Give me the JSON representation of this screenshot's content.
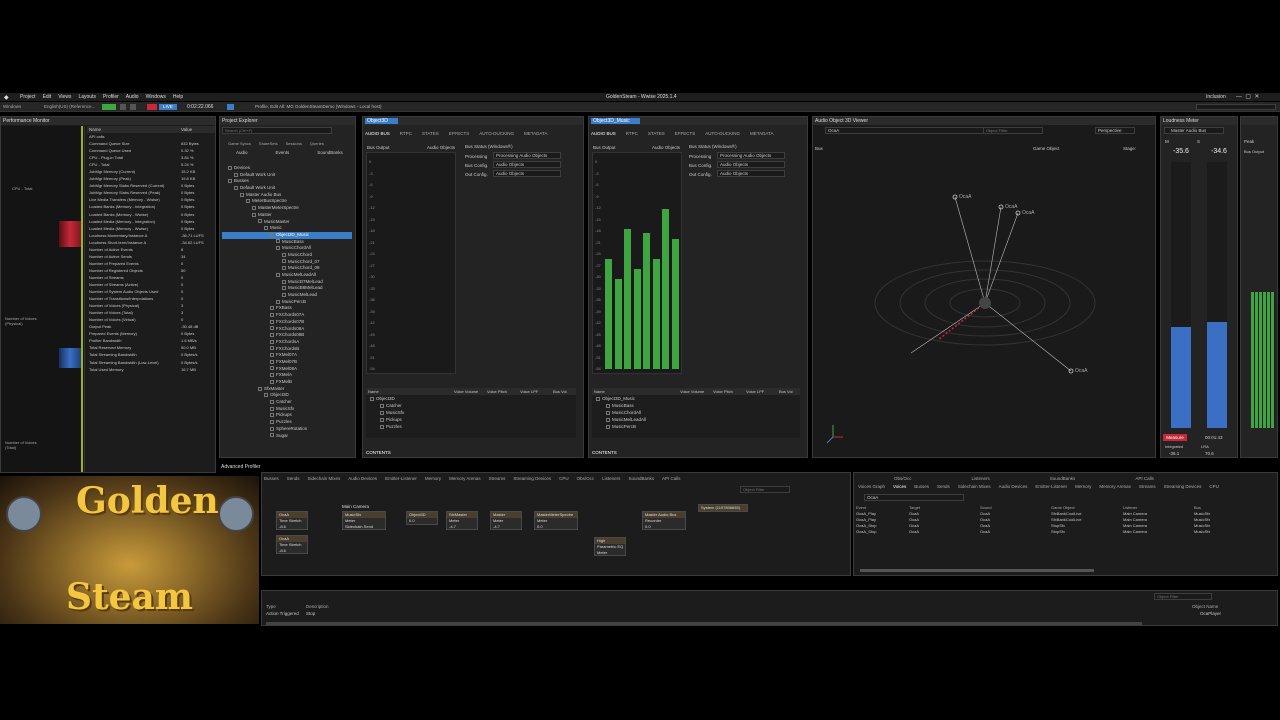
{
  "app": {
    "title": "GoldenSteam - Wwise 2025.1.4",
    "menu": [
      "Project",
      "Edit",
      "Views",
      "Layouts",
      "Profiler",
      "Audio",
      "Windows",
      "Help"
    ],
    "platform": "Windows",
    "language": "English(US) (Reference...",
    "live": "LIVE",
    "time": "0:02:22.066",
    "status": "Profile, Edit All: MG GoldenSteamDemo (Windows - Local host)",
    "user": "Inclusion"
  },
  "perf": {
    "title": "Performance Monitor",
    "col_name": "Name",
    "col_value": "Value",
    "label_cpu": "CPU - Total",
    "label_voices_phys": "Number of Voices (Physical)",
    "label_voices_total": "Number of Voices (Total)",
    "rows": [
      [
        "API calls",
        ""
      ],
      [
        "Command Queue Size",
        "832 Bytes"
      ],
      [
        "Command Queue Used",
        "0.32 %"
      ],
      [
        "CPU - Plug-in Total",
        "3.84 %"
      ],
      [
        "CPU - Total",
        "5.24 %"
      ],
      [
        "JobMgr Memory (Current)",
        "15.2 KB"
      ],
      [
        "JobMgr Memory (Peak)",
        "19.8 KB"
      ],
      [
        "JobMgr Memory Slabs Reserved (Current)",
        "0 Bytes"
      ],
      [
        "JobMgr Memory Slabs Reserved (Peak)",
        "0 Bytes"
      ],
      [
        "Live Media Transfers (Memory - Wwise)",
        "0 Bytes"
      ],
      [
        "Loaded Banks (Memory - Integration)",
        "0 Bytes"
      ],
      [
        "Loaded Banks (Memory - Wwise)",
        "0 Bytes"
      ],
      [
        "Loaded Media (Memory - Integration)",
        "0 Bytes"
      ],
      [
        "Loaded Media (Memory - Wwise)",
        "0 Bytes"
      ],
      [
        "Loudness Momentary/Instance A",
        "-36.71 LUFS"
      ],
      [
        "Loudness Short-term/Instance A",
        "-34.62 LUFS"
      ],
      [
        "Number of Active Events",
        "8"
      ],
      [
        "Number of Active Sends",
        "34"
      ],
      [
        "Number of Prepared Events",
        "0"
      ],
      [
        "Number of Registered Objects",
        "50"
      ],
      [
        "Number of Streams",
        "0"
      ],
      [
        "Number of Streams (Active)",
        "0"
      ],
      [
        "Number of System Audio Objects Used",
        "0"
      ],
      [
        "Number of Transitions/Interpolations",
        "0"
      ],
      [
        "Number of Voices (Physical)",
        "3"
      ],
      [
        "Number of Voices (Total)",
        "3"
      ],
      [
        "Number of Voices (Virtual)",
        "0"
      ],
      [
        "Output Peak",
        "-30.48 dB"
      ],
      [
        "Prepared Events (Memory)",
        "0 Bytes"
      ],
      [
        "Profiler Bandwidth",
        "1.6 MB/s"
      ],
      [
        "Total Reserved Memory",
        "50.0 MB"
      ],
      [
        "Total Streaming Bandwidth",
        "0 Bytes/s"
      ],
      [
        "Total Streaming Bandwidth (Low-Level)",
        "0 Bytes/s"
      ],
      [
        "Total Used Memory",
        "16.7 MB"
      ]
    ]
  },
  "explorer": {
    "title": "Project Explorer",
    "search": "Search (Ctrl+F)",
    "tabs_top": [
      "Game Syncs",
      "ShareSets",
      "Sessions",
      "Queries"
    ],
    "tabs": [
      "Audio",
      "Events",
      "SoundBanks"
    ],
    "items": [
      [
        "Devices",
        1
      ],
      [
        "Default Work Unit",
        2
      ],
      [
        "Busses",
        1
      ],
      [
        "Default Work Unit",
        2
      ],
      [
        "Master Audio Bus",
        3
      ],
      [
        "MeterBusSpectre",
        4
      ],
      [
        "MasterMeterSpectre",
        5
      ],
      [
        "Master",
        5
      ],
      [
        "MusicMaster",
        6
      ],
      [
        "Music",
        7
      ],
      [
        "Object3D_Music",
        8
      ],
      [
        "MusicBass",
        9
      ],
      [
        "MusicChordAll",
        9
      ],
      [
        "MusicChord",
        10
      ],
      [
        "MusicChord_07",
        10
      ],
      [
        "MusicChord_08",
        10
      ],
      [
        "MusicMelLeadAll",
        9
      ],
      [
        "MusicD7MelLead",
        10
      ],
      [
        "MusicB8MelLead",
        10
      ],
      [
        "MusicMelLead",
        10
      ],
      [
        "MusicPercB",
        9
      ],
      [
        "FXBass",
        8
      ],
      [
        "FXChords07A",
        8
      ],
      [
        "FXChords07B",
        8
      ],
      [
        "FXChords08A",
        8
      ],
      [
        "FXChords08B",
        8
      ],
      [
        "FXChordsA",
        8
      ],
      [
        "FXChordsB",
        8
      ],
      [
        "FXMel07A",
        8
      ],
      [
        "FXMel07B",
        8
      ],
      [
        "FXMel08A",
        8
      ],
      [
        "FXMelA",
        8
      ],
      [
        "FXMelB",
        8
      ],
      [
        "SfxMaster",
        6
      ],
      [
        "Object3D",
        7
      ],
      [
        "Catcher",
        8
      ],
      [
        "MusicSfx",
        8
      ],
      [
        "Pickups",
        8
      ],
      [
        "Puzzles",
        8
      ],
      [
        "SphereRotation",
        8
      ],
      [
        "Sugar",
        8
      ]
    ]
  },
  "bus1": {
    "title": "Object3D",
    "tabs": [
      "AUDIO BUS",
      "RTPC",
      "STATES",
      "EFFECTS",
      "AUTO-DUCKING",
      "METADATA"
    ],
    "label_output": "Bus Output",
    "label_objects": "Audio Objects",
    "label_status": "Bus Status (Windows®)",
    "processing_label": "Processing",
    "processing_value": "Processing Audio Objects",
    "busconfig_label": "Bus Config.",
    "busconfig_value": "Audio Objects",
    "outconfig_label": "Out Config.",
    "outconfig_value": "Audio Objects",
    "scale": [
      "0",
      "-3",
      "-6",
      "-9",
      "-12",
      "-15",
      "-18",
      "-21",
      "-24",
      "-27",
      "-30",
      "-33",
      "-36",
      "-39",
      "-42",
      "-45",
      "-48",
      "-51",
      "-54"
    ],
    "cols": [
      "Name",
      "Voice Volume",
      "Voice Pitch",
      "Voice LPF",
      "Bus Vol"
    ],
    "rows": [
      "Object3D",
      "Catcher",
      "MusicSfx",
      "Pickups",
      "Puzzles"
    ],
    "levels": [],
    "contents": "CONTENTS"
  },
  "bus2": {
    "title": "Object3D_Music",
    "tabs": [
      "AUDIO BUS",
      "RTPC",
      "STATES",
      "EFFECTS",
      "AUTO-DUCKING",
      "METADATA"
    ],
    "label_output": "Bus Output",
    "label_objects": "Audio Objects",
    "label_status": "Bus Status (Windows®)",
    "processing_label": "Processing",
    "processing_value": "Processing Audio Objects",
    "busconfig_label": "Bus Config.",
    "busconfig_value": "Audio Objects",
    "outconfig_label": "Out Config.",
    "outconfig_value": "Audio Objects",
    "scale": [
      "0",
      "-3",
      "-6",
      "-9",
      "-12",
      "-15",
      "-18",
      "-21",
      "-24",
      "-27",
      "-30",
      "-33",
      "-36",
      "-39",
      "-42",
      "-45",
      "-48",
      "-51",
      "-54"
    ],
    "cols": [
      "Name",
      "Voice Volume",
      "Voice Pitch",
      "Voice LPF",
      "Bus Vol"
    ],
    "rows": [
      "Object3D_Music",
      "MusicBass",
      "MusicChordAll",
      "MusicMelLeadAll",
      "MusicPercB"
    ],
    "levels": [
      0.55,
      0.45,
      0.7,
      0.5,
      0.68,
      0.55,
      0.8,
      0.65
    ],
    "contents": "CONTENTS"
  },
  "viewer": {
    "title": "Audio Object 3D Viewer",
    "bus_field": "OcaA",
    "search": "Object Filter",
    "mode": "Perspective",
    "bus_label": "Bus",
    "game_object_label": "Game Object",
    "stage_label": "Stage:",
    "labels": [
      "OcaA",
      "OcaA",
      "OcaA",
      "OcaA"
    ]
  },
  "loudness": {
    "title": "Loudness Meter",
    "bus": "Master Audio Bus",
    "bus_output": "Bus Output",
    "m_label": "M",
    "s_label": "S",
    "m_value": "-35.6",
    "s_value": "-34.6",
    "measure": "Measure",
    "time": "00:01:43",
    "integrated_label": "Integrated",
    "integrated_value": "-36.1",
    "lra_label": "LRA",
    "lra_value": "70.6",
    "peak": "Peak",
    "m_level": 0.38,
    "s_level": 0.4
  },
  "advanced": {
    "title": "Advanced Profiler",
    "tabs": [
      "Busses",
      "Sends",
      "Sidechain Mixes",
      "Audio Devices",
      "Emitter-Listener",
      "Memory",
      "Memory Arenas",
      "Streams",
      "Streaming Devices",
      "CPU",
      "Obs/Occ",
      "Listeners",
      "SoundBanks",
      "API Calls"
    ],
    "filter": "Object Filter"
  },
  "graph": {
    "nodes": [
      [
        "OcaA",
        "Time Stretch",
        "-8.6"
      ],
      [
        "OcaA",
        "Time Stretch",
        "-8.6"
      ],
      [
        "MusicSfx",
        "Meter",
        "Sidechain Send"
      ],
      [
        "Object3D",
        "0.0",
        ""
      ],
      [
        "SfxMaster",
        "Meter",
        "-4.7"
      ],
      [
        "Master",
        "Meter",
        "-4.7"
      ],
      [
        "MasterMeterSpectre",
        "Meter",
        "0.0"
      ],
      [
        "High",
        "Parametric EQ",
        "Meter"
      ],
      [
        "Master Audio Bus",
        "Recorder",
        "0.0"
      ],
      [
        "System (1197806655)",
        "",
        ""
      ]
    ],
    "camera": "Main Camera"
  },
  "voices": {
    "groups": [
      "Obs/Occ",
      "Listeners",
      "SoundBanks",
      "API Calls"
    ],
    "tabs": [
      "Voices Graph",
      "Voices",
      "Busses",
      "Sends",
      "Sidechain Mixes",
      "Audio Devices",
      "Emitter-Listener",
      "Memory",
      "Memory Arenas",
      "Streams",
      "Streaming Devices",
      "CPU"
    ],
    "filter": "OcaA",
    "cols": [
      "Event",
      "Target",
      "Sound",
      "Game Object",
      "Listener",
      "Bus"
    ],
    "rows": [
      [
        "OcaA_Play",
        "OcaA",
        "OcaA",
        "SfxBankCoolLive",
        "Main Camera",
        "MusicSfx"
      ],
      [
        "OcaA_Play",
        "OcaA",
        "OcaA",
        "SfxBankCoolLive",
        "Main Camera",
        "MusicSfx"
      ],
      [
        "OcaA_Stop",
        "OcaA",
        "OcaA",
        "StopSfx",
        "Main Camera",
        "MusicSfx"
      ],
      [
        "OcaA_Stop",
        "OcaA",
        "OcaA",
        "StopSfx",
        "Main Camera",
        "MusicSfx"
      ]
    ]
  },
  "log": {
    "filter": "Object Filter",
    "cols": [
      "Type",
      "Description"
    ],
    "type": "Action Triggered",
    "desc": "Stop",
    "obj_col": "Object Name",
    "obj": "OcaPlayer"
  },
  "thumbnail": {
    "line1": "Golden",
    "line2": "Steam"
  },
  "colors": {
    "accent": "#3a7ec8",
    "meter_green": "#3fa541",
    "meter_blue": "#3b6fc4",
    "measure": "#c8283a"
  }
}
